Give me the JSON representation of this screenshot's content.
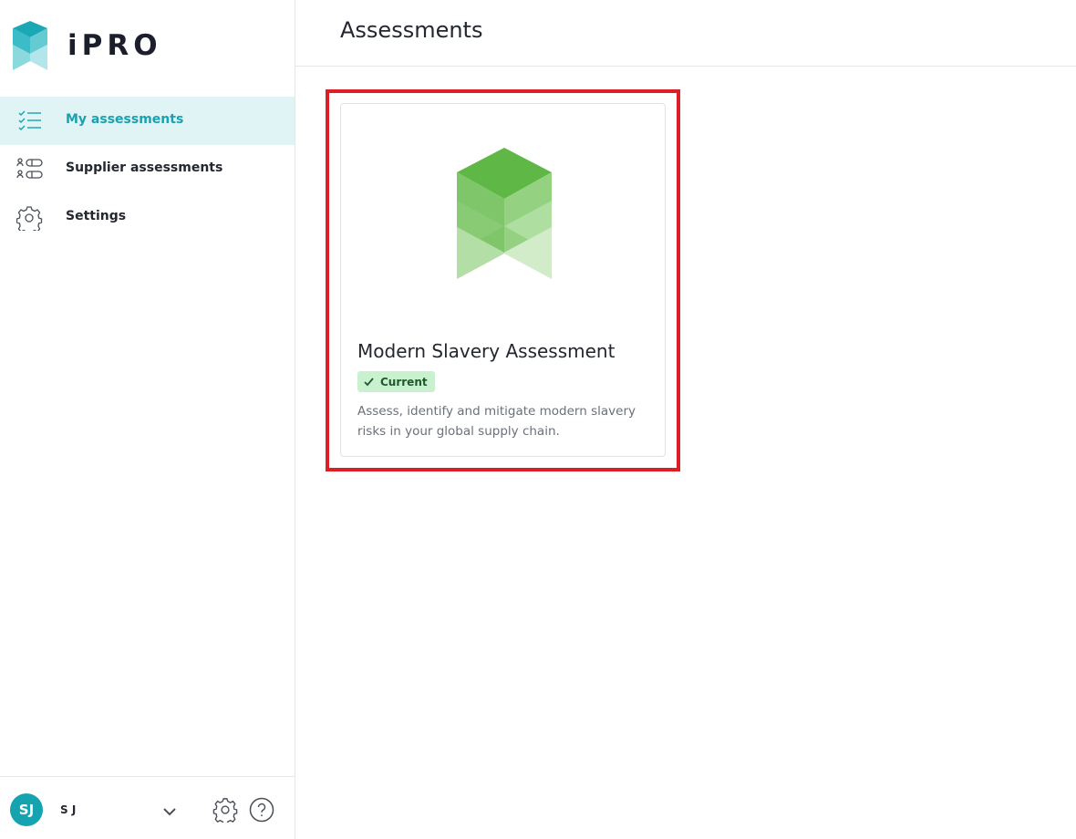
{
  "brand": {
    "name": "iPRO"
  },
  "sidebar": {
    "items": [
      {
        "label": "My assessments",
        "icon": "checklist-icon",
        "active": true
      },
      {
        "label": "Supplier assessments",
        "icon": "supplier-list-icon",
        "active": false
      },
      {
        "label": "Settings",
        "icon": "gear-icon",
        "active": false
      }
    ]
  },
  "user": {
    "initials": "SJ",
    "name": "S J"
  },
  "page": {
    "title": "Assessments"
  },
  "cards": [
    {
      "title": "Modern Slavery Assessment",
      "badge": "Current",
      "description": "Assess, identify and mitigate modern slavery risks in your global supply chain."
    }
  ],
  "colors": {
    "accent": "#1aa1b0",
    "active_bg": "#e0f4f5",
    "highlight": "#dc1f26",
    "badge_bg": "#c9f1cf",
    "logo_green": "#5fb846"
  }
}
